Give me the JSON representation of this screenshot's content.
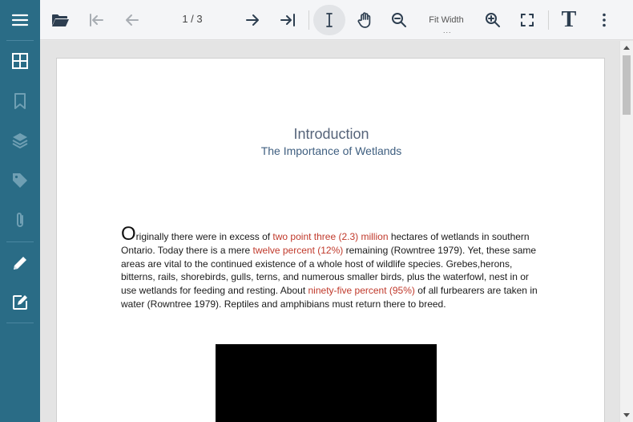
{
  "toolbar": {
    "page_indicator": "1 / 3",
    "fit_label": "Fit Width",
    "fit_dots": "...",
    "text_tool_glyph": "T"
  },
  "document": {
    "title": "Introduction",
    "subtitle": "The Importance of Wetlands",
    "drop_cap": "O",
    "paragraph_parts": [
      "riginally there were in excess of ",
      "two point three (2.3) million",
      " hectares of wetlands in southern Ontario. Today there is a mere ",
      "twelve percent (12%)",
      " remaining (Rowntree 1979). Yet, these same areas are vital to the continued existence of a whole host of wildlife species. Grebes,herons, bitterns, rails, shorebirds, gulls, terns, and numerous smaller birds, plus the waterfowl, nest in or use wetlands for feeding and resting. About ",
      "ninety-five percent (95%)",
      " of all furbearers are taken in water (Rowntree 1979). Reptiles and amphibians must return there to breed."
    ]
  },
  "icons": {
    "sidebar": [
      "menu-icon",
      "thumbnails-icon",
      "bookmark-icon",
      "layers-icon",
      "tag-icon",
      "attachment-icon",
      "pen-icon",
      "edit-icon"
    ],
    "toolbar": [
      "folder-open-icon",
      "first-page-icon",
      "previous-page-icon",
      "next-page-icon",
      "last-page-icon",
      "text-cursor-icon",
      "hand-icon",
      "zoom-out-icon",
      "zoom-in-icon",
      "fullscreen-icon",
      "text-tool-icon",
      "more-vertical-icon"
    ]
  },
  "colors": {
    "sidebar_bg": "#2a6c86",
    "highlight_text": "#c0392b",
    "title_text": "#56647a"
  }
}
